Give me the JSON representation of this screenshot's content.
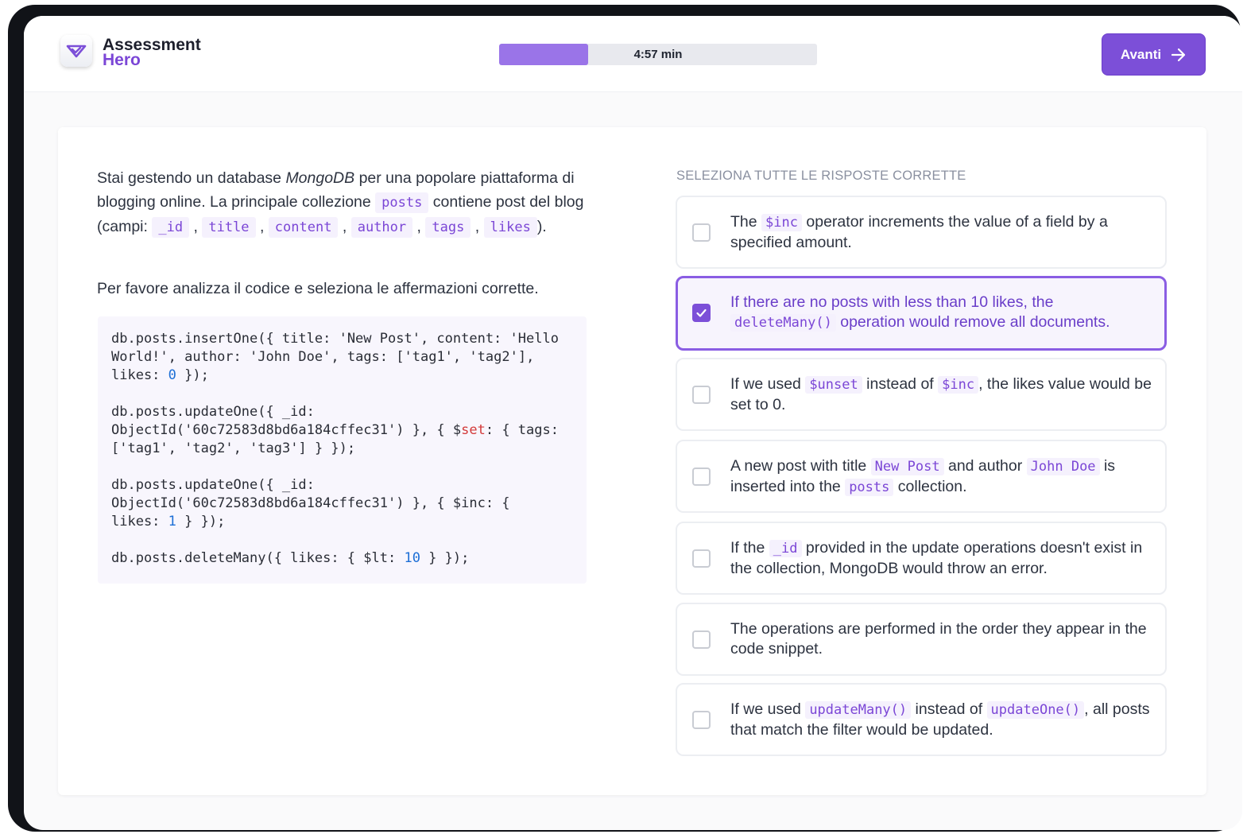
{
  "header": {
    "logo_line1": "Assessment",
    "logo_line2": "Hero",
    "timer": "4:57 min",
    "progress": 0.28,
    "next_label": "Avanti"
  },
  "question": {
    "p1_a": "Stai gestendo un database ",
    "p1_em": "MongoDB",
    "p1_b": " per una popolare piattaforma di blogging online. La principale collezione ",
    "p1_chip_posts": "posts",
    "p1_c": " contiene post del blog (campi: ",
    "fields": [
      "_id",
      "title",
      "content",
      "author",
      "tags",
      "likes"
    ],
    "p1_end": ").",
    "p2": "Per favore analizza il codice e seleziona le affermazioni corrette.",
    "code": {
      "l1a": "db.posts.insertOne({ title: ",
      "l1b": "'New Post'",
      "l1c": ", content: ",
      "l1d": "'Hello",
      "l2a": "World!'",
      "l2b": ", author: ",
      "l2c": "'John Doe'",
      "l2d": ", tags: [",
      "l2e": "'tag1'",
      "l2f": ", ",
      "l2g": "'tag2'",
      "l2h": "],",
      "l3a": "likes: ",
      "l3b": "0",
      "l3c": " });",
      "l4": "db.posts.updateOne({ _id:",
      "l5a": "ObjectId(",
      "l5b": "'60c72583d8bd6a184cffec31'",
      "l5c": ") }, { $",
      "l5d": "set",
      "l5e": ": { tags:",
      "l6a": "[",
      "l6b": "'tag1'",
      "l6c": ", ",
      "l6d": "'tag2'",
      "l6e": ", ",
      "l6f": "'tag3'",
      "l6g": "] } });",
      "l7": "db.posts.updateOne({ _id:",
      "l8a": "ObjectId(",
      "l8b": "'60c72583d8bd6a184cffec31'",
      "l8c": ") }, { $inc: {",
      "l9a": "likes: ",
      "l9b": "1",
      "l9c": " } });",
      "l10a": "db.posts.deleteMany({ likes: { $lt: ",
      "l10b": "10",
      "l10c": " } });"
    }
  },
  "answers": {
    "heading": "SELEZIONA TUTTE LE RISPOSTE CORRETTE",
    "o1": {
      "a": "The ",
      "c1": "$inc",
      "b": " operator increments the value of a field by a specified amount.",
      "checked": false
    },
    "o2": {
      "a": "If there are no posts with less than 10 likes, the ",
      "c1": "deleteMany()",
      "b": " operation would remove all documents.",
      "checked": true
    },
    "o3": {
      "a": "If we used ",
      "c1": "$unset",
      "b": " instead of ",
      "c2": "$inc",
      "c": ", the likes value would be set to 0.",
      "checked": false
    },
    "o4": {
      "a": "A new post with title ",
      "c1": "New Post",
      "b": " and author ",
      "c2": "John Doe",
      "c": " is inserted into the ",
      "c3": "posts",
      "d": " collection.",
      "checked": false
    },
    "o5": {
      "a": "If the ",
      "c1": "_id",
      "b": " provided in the update operations doesn't exist in the collection, MongoDB would throw an error.",
      "checked": false
    },
    "o6": {
      "a": "The operations are performed in the order they appear in the code snippet.",
      "checked": false
    },
    "o7": {
      "a": "If we used ",
      "c1": "updateMany()",
      "b": " instead of ",
      "c2": "updateOne()",
      "c": ", all posts that match the filter would be updated.",
      "checked": false
    }
  },
  "colors": {
    "accent": "#7c4fd8",
    "chip_text": "#7b46d6",
    "chip_bg": "#f5f1fd"
  },
  "icons": {
    "logo": "check-shield-icon",
    "next": "arrow-right-icon",
    "check": "checkmark-icon"
  }
}
